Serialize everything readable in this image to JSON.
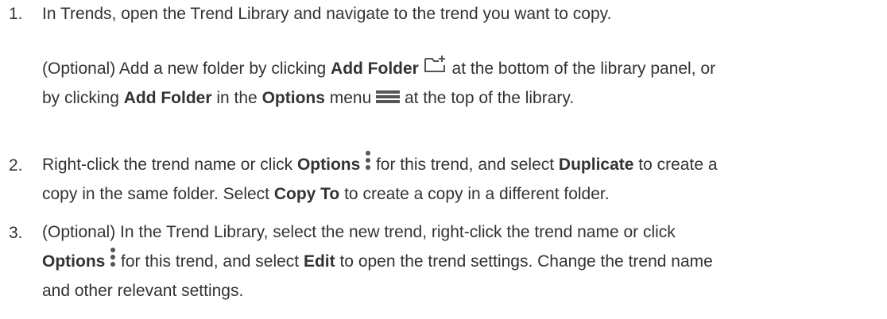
{
  "steps": [
    {
      "number": "1.",
      "text": "In Trends, open the Trend Library and navigate to the trend you want to copy.",
      "optional": {
        "t1": "(Optional) Add a new folder by clicking ",
        "b1": "Add Folder",
        "t2": " at the bottom of the library panel, or",
        "t3": "by clicking ",
        "b2": "Add Folder",
        "t4": " in the ",
        "b3": "Options",
        "t5": " menu ",
        "t6": " at the top of the library."
      }
    },
    {
      "number": "2.",
      "t1": "Right-click the trend name or click ",
      "b1": "Options",
      "t2": " for this trend, and select ",
      "b2": "Duplicate",
      "t3": " to create a",
      "t4": "copy in the same folder. Select ",
      "b3": "Copy To",
      "t5": " to create a copy in a different folder."
    },
    {
      "number": "3.",
      "t1": "(Optional) In the Trend Library, select the new trend, right-click the trend name or click",
      "b1": "Options",
      "t2": " for this trend, and select ",
      "b2": "Edit",
      "t3": " to open the trend settings. Change the trend name",
      "t4": "and other relevant settings."
    }
  ],
  "icons": {
    "add_folder": "add-folder-icon",
    "options_menu": "hamburger-menu-icon",
    "options_kebab": "vertical-ellipsis-icon"
  },
  "colors": {
    "text": "#333333",
    "icon": "#555555"
  }
}
